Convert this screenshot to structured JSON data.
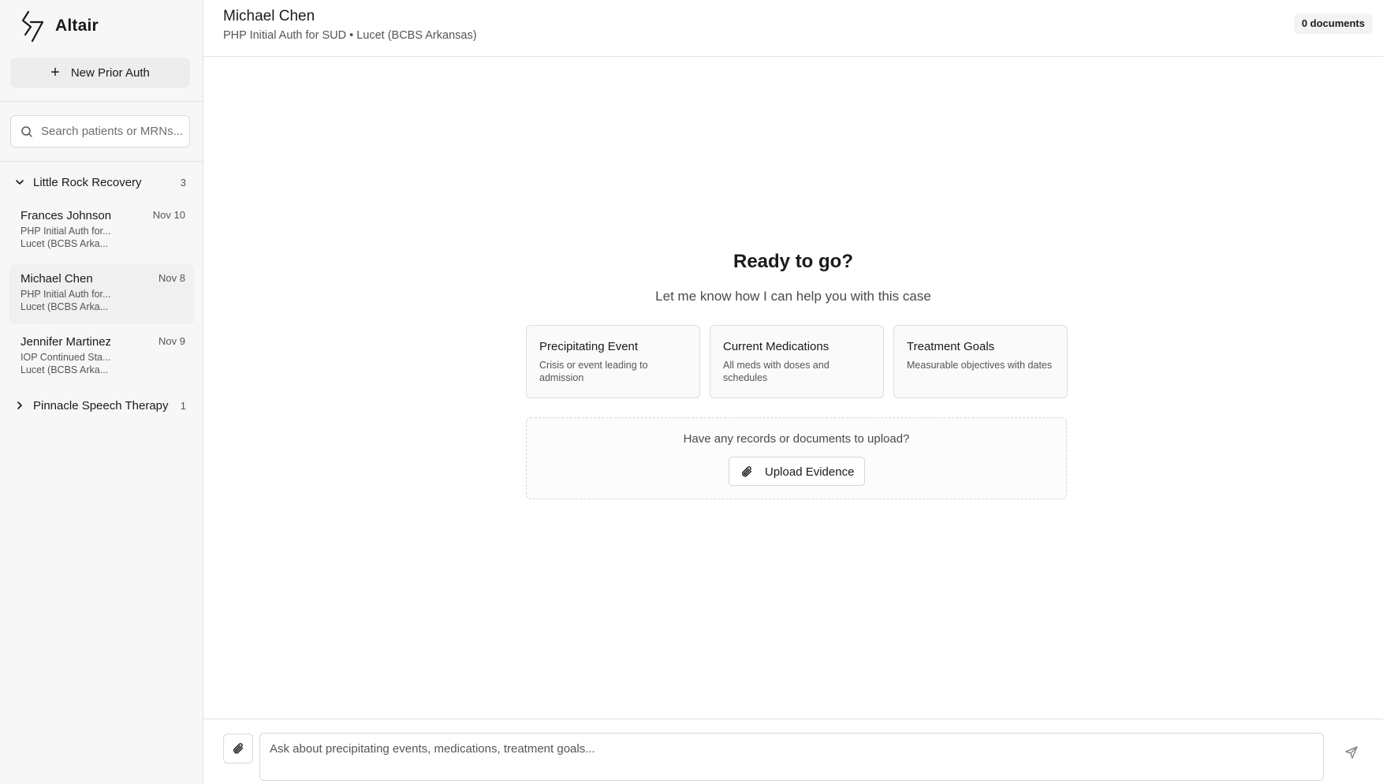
{
  "app": {
    "name": "Altair",
    "logo_icon": "altair-logo-icon"
  },
  "sidebar": {
    "new_button_label": "New Prior Auth",
    "search_placeholder": "Search patients or MRNs...",
    "groups": [
      {
        "name": "Little Rock Recovery",
        "count": "3",
        "expanded": true,
        "items": [
          {
            "name": "Frances Johnson",
            "date": "Nov 10",
            "line1": "PHP Initial Auth for...",
            "line2": "Lucet (BCBS Arka..."
          },
          {
            "name": "Michael Chen",
            "date": "Nov 8",
            "line1": "PHP Initial Auth for...",
            "line2": "Lucet (BCBS Arka...",
            "selected": true
          },
          {
            "name": "Jennifer Martinez",
            "date": "Nov 9",
            "line1": "IOP Continued Sta...",
            "line2": "Lucet (BCBS Arka..."
          }
        ]
      },
      {
        "name": "Pinnacle Speech Therapy",
        "count": "1",
        "expanded": false
      }
    ]
  },
  "header": {
    "patient_name": "Michael Chen",
    "subtitle": "PHP Initial Auth for SUD • Lucet (BCBS Arkansas)",
    "documents_badge": "0 documents"
  },
  "empty_state": {
    "title": "Ready to go?",
    "subtitle": "Let me know how I can help you with this case",
    "cards": [
      {
        "title": "Precipitating Event",
        "description": "Crisis or event leading to admission"
      },
      {
        "title": "Current Medications",
        "description": "All meds with doses and schedules"
      },
      {
        "title": "Treatment Goals",
        "description": "Measurable objectives with dates"
      }
    ],
    "upload": {
      "question": "Have any records or documents to upload?",
      "button_label": "Upload Evidence"
    }
  },
  "composer": {
    "placeholder": "Ask about precipitating events, medications, treatment goals..."
  },
  "colors": {
    "sidebar_bg": "#f7f7f7",
    "border": "#e2e2e2",
    "text": "#1a1a1a",
    "muted": "#555555"
  }
}
